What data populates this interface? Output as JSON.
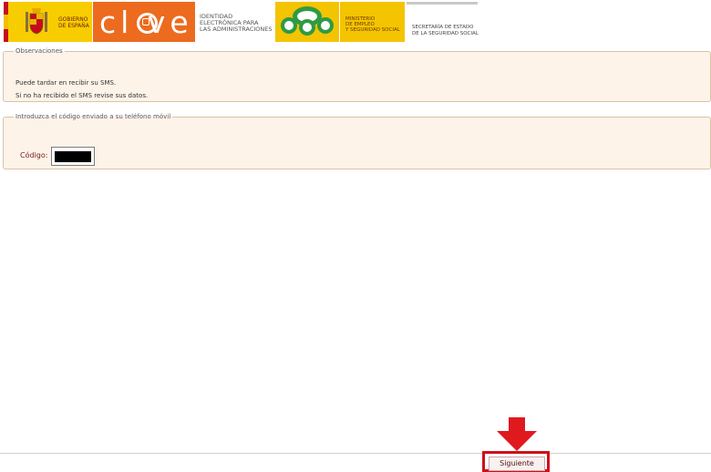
{
  "header": {
    "gobierno_text": "GOBIERNO\nDE ESPAÑA",
    "clave_logo": "cl ve",
    "identidad_text": "IDENTIDAD\nELECTRÓNICA PARA\nLAS ADMINISTRACIONES",
    "ministerio_text": "MINISTERIO\nDE EMPLEO\nY SEGURIDAD SOCIAL",
    "secretaria_text": "SECRETARÍA DE ESTADO\nDE LA SEGURIDAD SOCIAL",
    "colors": {
      "gobierno_yellow": "#f7cd00",
      "clave_orange": "#ec6b1f",
      "ministerio_yellow": "#f4c400",
      "spain_red": "#c60b1e"
    }
  },
  "observaciones": {
    "legend": "Observaciones",
    "lines": [
      "Puede tardar en recibir su SMS.",
      "Si no ha recibido el SMS revise sus datos."
    ]
  },
  "codigo": {
    "legend": "Introduzca el código enviado a su teléfono móvil",
    "label": "Código:",
    "value": "",
    "redacted": true
  },
  "footer": {
    "next_button": "Siguiente",
    "highlight_color": "#d0101a",
    "arrow_icon": "arrow-down-icon"
  }
}
